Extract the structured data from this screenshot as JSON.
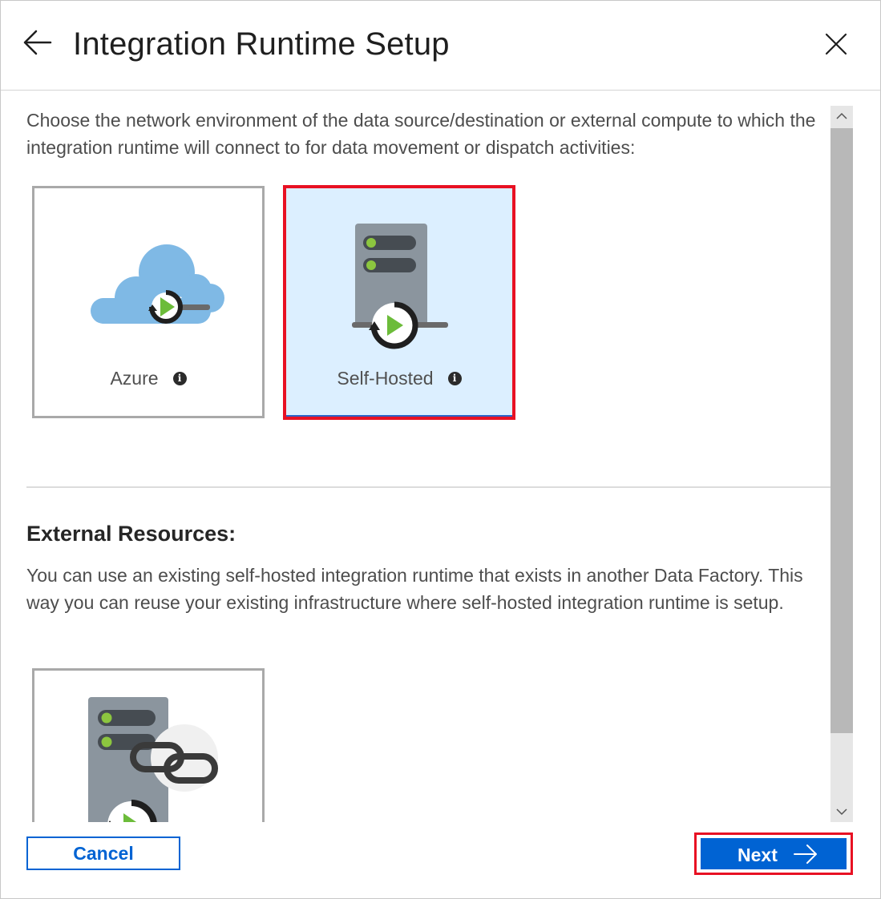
{
  "dialog": {
    "title": "Integration Runtime Setup"
  },
  "content": {
    "intro": "Choose the network environment of the data source/destination or external compute to which the integration runtime will connect to for data movement or dispatch activities:",
    "options": [
      {
        "label": "Azure",
        "icon": "azure-cloud-icon",
        "selected": false
      },
      {
        "label": "Self-Hosted",
        "icon": "server-icon",
        "selected": true
      }
    ],
    "external": {
      "heading": "External Resources:",
      "description": "You can use an existing self-hosted integration runtime that exists in another Data Factory. This way you can reuse your existing infrastructure where self-hosted integration runtime is setup.",
      "icon": "linked-server-icon"
    }
  },
  "footer": {
    "cancel_label": "Cancel",
    "next_label": "Next"
  },
  "colors": {
    "accent": "#0063d3",
    "highlight": "#e81123",
    "selected_bg": "#dcefff",
    "play_green": "#6cbc3a"
  }
}
